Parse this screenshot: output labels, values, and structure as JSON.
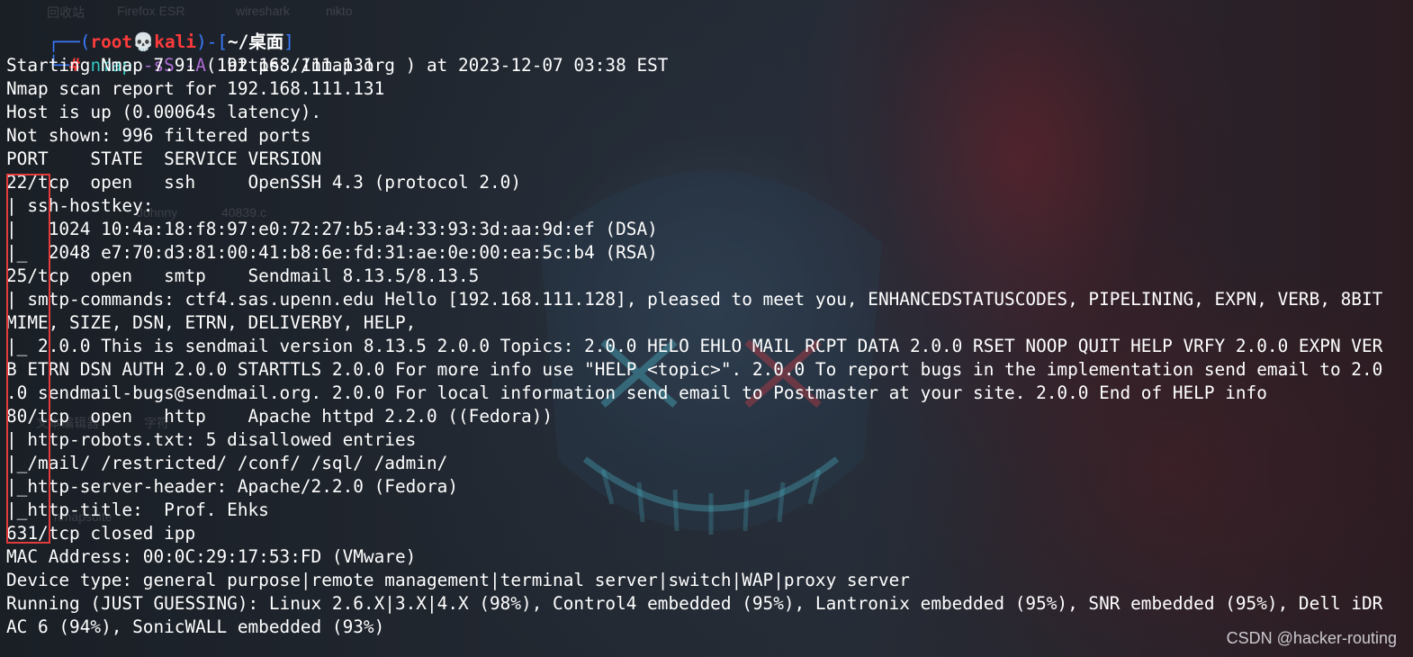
{
  "prompt": {
    "line1_prefix": "┌──(",
    "user": "root",
    "skull": "💀",
    "host": "kali",
    "sep": ")-[",
    "cwd": "~/桌面",
    "close": "]",
    "line2_prefix": "└─",
    "hash": "#",
    "command": "nmap",
    "flags": "-sS -A",
    "target": "192.168.111.131"
  },
  "output_lines": [
    "Starting Nmap 7.91 ( https://nmap.org ) at 2023-12-07 03:38 EST",
    "Nmap scan report for 192.168.111.131",
    "Host is up (0.00064s latency).",
    "Not shown: 996 filtered ports",
    "PORT    STATE  SERVICE VERSION",
    "22/tcp  open   ssh     OpenSSH 4.3 (protocol 2.0)",
    "| ssh-hostkey:",
    "|   1024 10:4a:18:f8:97:e0:72:27:b5:a4:33:93:3d:aa:9d:ef (DSA)",
    "|_  2048 e7:70:d3:81:00:41:b8:6e:fd:31:ae:0e:00:ea:5c:b4 (RSA)",
    "25/tcp  open   smtp    Sendmail 8.13.5/8.13.5",
    "| smtp-commands: ctf4.sas.upenn.edu Hello [192.168.111.128], pleased to meet you, ENHANCEDSTATUSCODES, PIPELINING, EXPN, VERB, 8BIT",
    "MIME, SIZE, DSN, ETRN, DELIVERBY, HELP,",
    "|_ 2.0.0 This is sendmail version 8.13.5 2.0.0 Topics: 2.0.0 HELO EHLO MAIL RCPT DATA 2.0.0 RSET NOOP QUIT HELP VRFY 2.0.0 EXPN VER",
    "B ETRN DSN AUTH 2.0.0 STARTTLS 2.0.0 For more info use \"HELP <topic>\". 2.0.0 To report bugs in the implementation send email to 2.0",
    ".0 sendmail-bugs@sendmail.org. 2.0.0 For local information send email to Postmaster at your site. 2.0.0 End of HELP info",
    "80/tcp  open   http    Apache httpd 2.2.0 ((Fedora))",
    "| http-robots.txt: 5 disallowed entries",
    "|_/mail/ /restricted/ /conf/ /sql/ /admin/",
    "|_http-server-header: Apache/2.2.0 (Fedora)",
    "|_http-title:  Prof. Ehks",
    "631/tcp closed ipp",
    "MAC Address: 00:0C:29:17:53:FD (VMware)",
    "Device type: general purpose|remote management|terminal server|switch|WAP|proxy server",
    "Running (JUST GUESSING): Linux 2.6.X|3.X|4.X (98%), Control4 embedded (95%), Lantronix embedded (95%), SNR embedded (95%), Dell iDR",
    "AC 6 (94%), SonicWALL embedded (93%)"
  ],
  "desktop_ghosts": {
    "ghost1": "回收站",
    "ghost2": "Firefox ESR",
    "ghost3": "wireshark",
    "ghost4": "nikto",
    "ghost5": "Johnny",
    "ghost6": "40839.c",
    "ghost7": "文本编辑器",
    "ghost8": "字符",
    "ghost9": "nmapsuite"
  },
  "watermark": "CSDN @hacker-routing",
  "colors": {
    "prompt_blue": "#3b7bff",
    "prompt_red": "#ff3b3b",
    "command_cyan": "#2fc7c0",
    "flags_magenta": "#b06cd6",
    "highlight_box": "#e43c3c"
  }
}
